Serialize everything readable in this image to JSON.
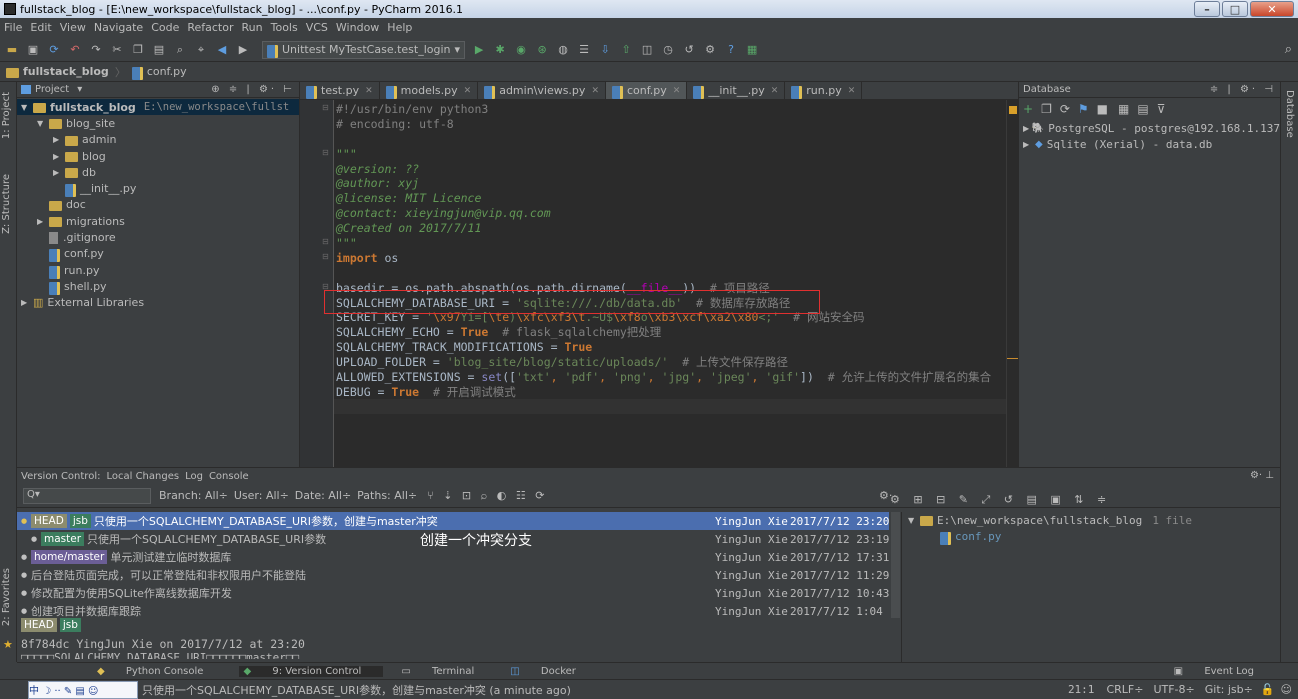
{
  "window": {
    "title": "fullstack_blog - [E:\\new_workspace\\fullstack_blog] - ...\\conf.py - PyCharm 2016.1"
  },
  "menu": [
    "File",
    "Edit",
    "View",
    "Navigate",
    "Code",
    "Refactor",
    "Run",
    "Tools",
    "VCS",
    "Window",
    "Help"
  ],
  "toolbar": {
    "run_config": "Unittest MyTestCase.test_login"
  },
  "breadcrumb": {
    "project": "fullstack_blog",
    "file": "conf.py"
  },
  "project_panel": {
    "header": "Project",
    "items": [
      {
        "label": "fullstack_blog",
        "extra": "E:\\new_workspace\\fullst",
        "type": "folder",
        "depth": 0,
        "expanded": true,
        "selected": true
      },
      {
        "label": "blog_site",
        "type": "folder",
        "depth": 1,
        "expanded": true
      },
      {
        "label": "admin",
        "type": "folder",
        "depth": 2
      },
      {
        "label": "blog",
        "type": "folder",
        "depth": 2
      },
      {
        "label": "db",
        "type": "folder",
        "depth": 2
      },
      {
        "label": "__init__.py",
        "type": "py",
        "depth": 2
      },
      {
        "label": "doc",
        "type": "folder",
        "depth": 1
      },
      {
        "label": "migrations",
        "type": "folder",
        "depth": 1
      },
      {
        "label": ".gitignore",
        "type": "file",
        "depth": 1
      },
      {
        "label": "conf.py",
        "type": "py",
        "depth": 1
      },
      {
        "label": "run.py",
        "type": "py",
        "depth": 1
      },
      {
        "label": "shell.py",
        "type": "py",
        "depth": 1
      },
      {
        "label": "External Libraries",
        "type": "lib",
        "depth": 0
      }
    ]
  },
  "editor": {
    "tabs": [
      {
        "label": "test.py",
        "active": false
      },
      {
        "label": "models.py",
        "active": false
      },
      {
        "label": "admin\\views.py",
        "active": false
      },
      {
        "label": "conf.py",
        "active": true
      },
      {
        "label": "__init__.py",
        "active": false
      },
      {
        "label": "run.py",
        "active": false
      }
    ],
    "lines": [
      [
        {
          "t": "#!/usr/bin/env python3",
          "c": "cm"
        }
      ],
      [
        {
          "t": "# encoding: utf-8",
          "c": "cm"
        }
      ],
      [
        {
          "t": "",
          "c": ""
        }
      ],
      [
        {
          "t": "\"\"\"",
          "c": "doc"
        }
      ],
      [
        {
          "t": "@version: ??",
          "c": "doc"
        }
      ],
      [
        {
          "t": "@author: xyj",
          "c": "doc"
        }
      ],
      [
        {
          "t": "@license: MIT Licence",
          "c": "doc"
        }
      ],
      [
        {
          "t": "@contact: xieyingjun@vip.qq.com",
          "c": "doc"
        }
      ],
      [
        {
          "t": "@Created on 2017/7/11",
          "c": "doc"
        }
      ],
      [
        {
          "t": "\"\"\"",
          "c": "doc"
        }
      ],
      [
        {
          "t": "import",
          "c": "kw"
        },
        {
          "t": " os",
          "c": "cn"
        }
      ],
      [
        {
          "t": "",
          "c": ""
        }
      ],
      [
        {
          "t": "basedir = os.path.abspath(os.path.dirname(",
          "c": "cn"
        },
        {
          "t": "__file__",
          "c": "mg"
        },
        {
          "t": "))  ",
          "c": "cn"
        },
        {
          "t": "# 项目路径",
          "c": "cm"
        }
      ],
      [
        {
          "t": "SQLALCHEMY_DATABASE_URI = ",
          "c": "cn"
        },
        {
          "t": "'sqlite:///./db/data.db'",
          "c": "st"
        },
        {
          "t": "  ",
          "c": "cn"
        },
        {
          "t": "# 数据库存放路径",
          "c": "cm"
        }
      ],
      [
        {
          "t": "SECRET_KEY = ",
          "c": "cn"
        },
        {
          "t": "'",
          "c": "st"
        },
        {
          "t": "\\x97",
          "c": "es"
        },
        {
          "t": "Yi=[",
          "c": "st"
        },
        {
          "t": "\\te",
          "c": "es"
        },
        {
          "t": ")",
          "c": "st"
        },
        {
          "t": "\\xfc\\xf3\\t",
          "c": "es"
        },
        {
          "t": ".~U$",
          "c": "st"
        },
        {
          "t": "\\xf8",
          "c": "es"
        },
        {
          "t": "o",
          "c": "st"
        },
        {
          "t": "\\xb3\\xcf\\xa2\\x80",
          "c": "es"
        },
        {
          "t": "<;'",
          "c": "st"
        },
        {
          "t": "  ",
          "c": "cn"
        },
        {
          "t": "# 网站安全码",
          "c": "cm"
        }
      ],
      [
        {
          "t": "SQLALCHEMY_ECHO = ",
          "c": "cn"
        },
        {
          "t": "True",
          "c": "kw"
        },
        {
          "t": "  ",
          "c": "cn"
        },
        {
          "t": "# flask_sqlalchemy把处理",
          "c": "cm"
        }
      ],
      [
        {
          "t": "SQLALCHEMY_TRACK_MODIFICATIONS = ",
          "c": "cn"
        },
        {
          "t": "True",
          "c": "kw"
        }
      ],
      [
        {
          "t": "UPLOAD_FOLDER = ",
          "c": "cn"
        },
        {
          "t": "'blog_site/blog/static/uploads/'",
          "c": "st"
        },
        {
          "t": "  ",
          "c": "cn"
        },
        {
          "t": "# 上传文件保存路径",
          "c": "cm"
        }
      ],
      [
        {
          "t": "ALLOWED_EXTENSIONS = ",
          "c": "cn"
        },
        {
          "t": "set",
          "c": "bi"
        },
        {
          "t": "([",
          "c": "cn"
        },
        {
          "t": "'txt'",
          "c": "st"
        },
        {
          "t": ", ",
          "c": "es"
        },
        {
          "t": "'pdf'",
          "c": "st"
        },
        {
          "t": ", ",
          "c": "es"
        },
        {
          "t": "'png'",
          "c": "st"
        },
        {
          "t": ", ",
          "c": "es"
        },
        {
          "t": "'jpg'",
          "c": "st"
        },
        {
          "t": ", ",
          "c": "es"
        },
        {
          "t": "'jpeg'",
          "c": "st"
        },
        {
          "t": ", ",
          "c": "es"
        },
        {
          "t": "'gif'",
          "c": "st"
        },
        {
          "t": "])",
          "c": "cn"
        },
        {
          "t": "  ",
          "c": "cn"
        },
        {
          "t": "# 允许上传的文件扩展名的集合",
          "c": "cm"
        }
      ],
      [
        {
          "t": "DEBUG = ",
          "c": "cn"
        },
        {
          "t": "True",
          "c": "kw"
        },
        {
          "t": "  ",
          "c": "cn"
        },
        {
          "t": "# 开启调试模式",
          "c": "cm"
        }
      ]
    ]
  },
  "database_panel": {
    "header": "Database",
    "items": [
      "PostgreSQL - postgres@192.168.1.137",
      "Sqlite (Xerial) - data.db"
    ]
  },
  "side_tabs": {
    "left_top": "1: Project",
    "left_mid": "Z: Structure",
    "left_bottom": "2: Favorites",
    "right": "Database"
  },
  "vcs": {
    "tabs": [
      "Version Control:",
      "Local Changes",
      "Log",
      "Console"
    ],
    "filters": [
      "Branch: All",
      "User: All",
      "Date: All",
      "Paths: All"
    ],
    "commits": [
      {
        "labels": [
          {
            "t": "HEAD",
            "k": "head"
          },
          {
            "t": "jsb",
            "k": "jsb"
          }
        ],
        "msg": "只使用一个SQLALCHEMY_DATABASE_URI参数，创建与master冲突",
        "author": "YingJun Xie",
        "date": "2017/7/12 23:20",
        "selected": true
      },
      {
        "labels": [
          {
            "t": "master",
            "k": "master"
          }
        ],
        "msg": "只使用一个SQLALCHEMY_DATABASE_URI参数",
        "author": "YingJun Xie",
        "date": "2017/7/12 23:19",
        "selected": false
      },
      {
        "labels": [
          {
            "t": "home/master",
            "k": "remote"
          }
        ],
        "msg": "单元测试建立临时数据库",
        "author": "YingJun Xie",
        "date": "2017/7/12 17:31",
        "selected": false
      },
      {
        "labels": [],
        "msg": "后台登陆页面完成，可以正常登陆和非权限用户不能登陆",
        "author": "YingJun Xie",
        "date": "2017/7/12 11:29",
        "selected": false
      },
      {
        "labels": [],
        "msg": "修改配置为使用SQLite作离线数据库开发",
        "author": "YingJun Xie",
        "date": "2017/7/12 10:43",
        "selected": false
      },
      {
        "labels": [],
        "msg": "创建项目并数据库跟踪",
        "author": "YingJun Xie",
        "date": "2017/7/12 1:04",
        "selected": false
      }
    ],
    "annotation": "创建一个冲突分支",
    "detail_labels": [
      "HEAD",
      "jsb"
    ],
    "detail_commit": "8f784dc YingJun Xie on 2017/7/12 at 23:20",
    "detail_msg": "□□□□□SQLALCHEMY_DATABASE_URI□□□□□□master□□",
    "changed_root": "E:\\new_workspace\\fullstack_blog",
    "changed_count": "1 file",
    "changed_file": "conf.py"
  },
  "bottom_tabs": [
    "Python Console",
    "9: Version Control",
    "Terminal",
    "Docker"
  ],
  "event_log": "Event Log",
  "status": {
    "message": "只使用一个SQLALCHEMY_DATABASE_URI参数，创建与master冲突 (a minute ago)",
    "ime": "中 ☽ ·· ✎ ▤ ☺",
    "position": "21:1",
    "line_sep": "CRLF÷",
    "encoding": "UTF-8÷",
    "git": "Git: jsb÷"
  }
}
